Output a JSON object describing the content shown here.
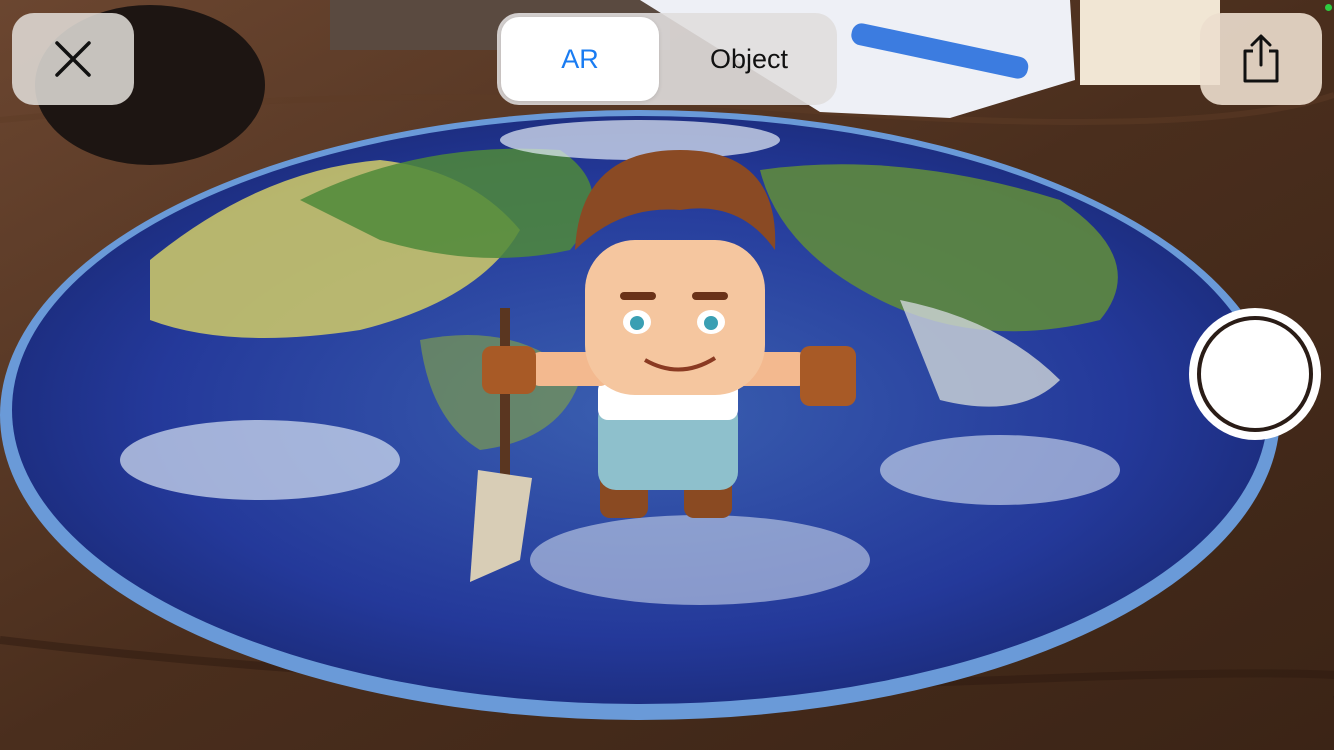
{
  "toolbar": {
    "close_icon": "close-icon",
    "share_icon": "share-icon"
  },
  "mode_switcher": {
    "selected": "AR",
    "options": [
      {
        "label": "AR"
      },
      {
        "label": "Object"
      }
    ]
  },
  "shutter": {
    "icon": "shutter-button"
  },
  "colors": {
    "accent": "#1a7cf2",
    "status_indicator": "#2ecc40"
  }
}
